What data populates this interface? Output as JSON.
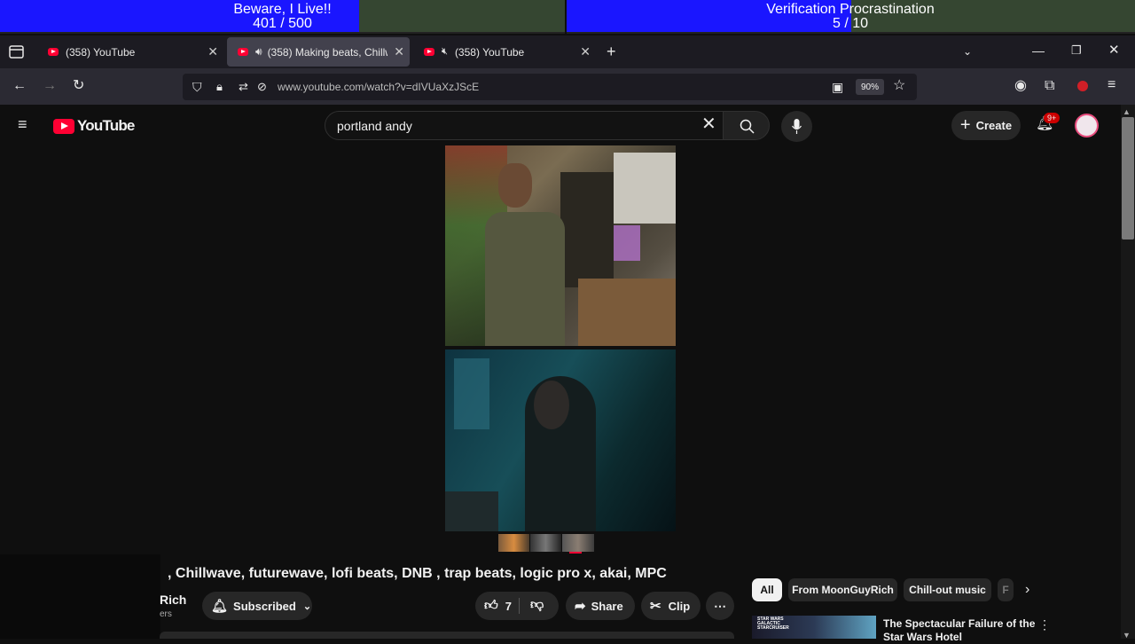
{
  "overlays": {
    "left": {
      "title": "Beware, I Live!!",
      "count": "401 / 500",
      "progress": 0.802
    },
    "right": {
      "title": "Verification Procrastination",
      "count": "5 / 10",
      "progress": 0.5
    }
  },
  "browser": {
    "tabs": [
      {
        "label": "(358) YouTube"
      },
      {
        "label": "(358) Making beats, Chillwa"
      },
      {
        "label": "(358) YouTube"
      }
    ],
    "url": "www.youtube.com/watch?v=dIVUaXzJScE",
    "zoom": "90%"
  },
  "youtube": {
    "logo": "YouTube",
    "search_value": "portland andy",
    "create_label": "Create",
    "notif_badge": "9+",
    "video_title": ", Chillwave, futurewave, lofi beats, DNB , trap beats, logic pro x, akai, MPC",
    "channel_partial": "Rich",
    "subs_partial": "ers",
    "subscribed_label": "Subscribed",
    "likes": "7",
    "share_label": "Share",
    "clip_label": "Clip",
    "chips": [
      "All",
      "From MoonGuyRich",
      "Chill-out music",
      "F"
    ],
    "rec_title_line1": "The Spectacular Failure of the",
    "rec_title_line2": "Star Wars Hotel",
    "rec_thumb_text1": "STAR WARS",
    "rec_thumb_text2": "GALACTIC",
    "rec_thumb_text3": "STARCRUISER"
  },
  "colors": {
    "accent_red": "#ff0033",
    "progress_blue": "#1a16ff",
    "progress_bg": "#354631"
  }
}
